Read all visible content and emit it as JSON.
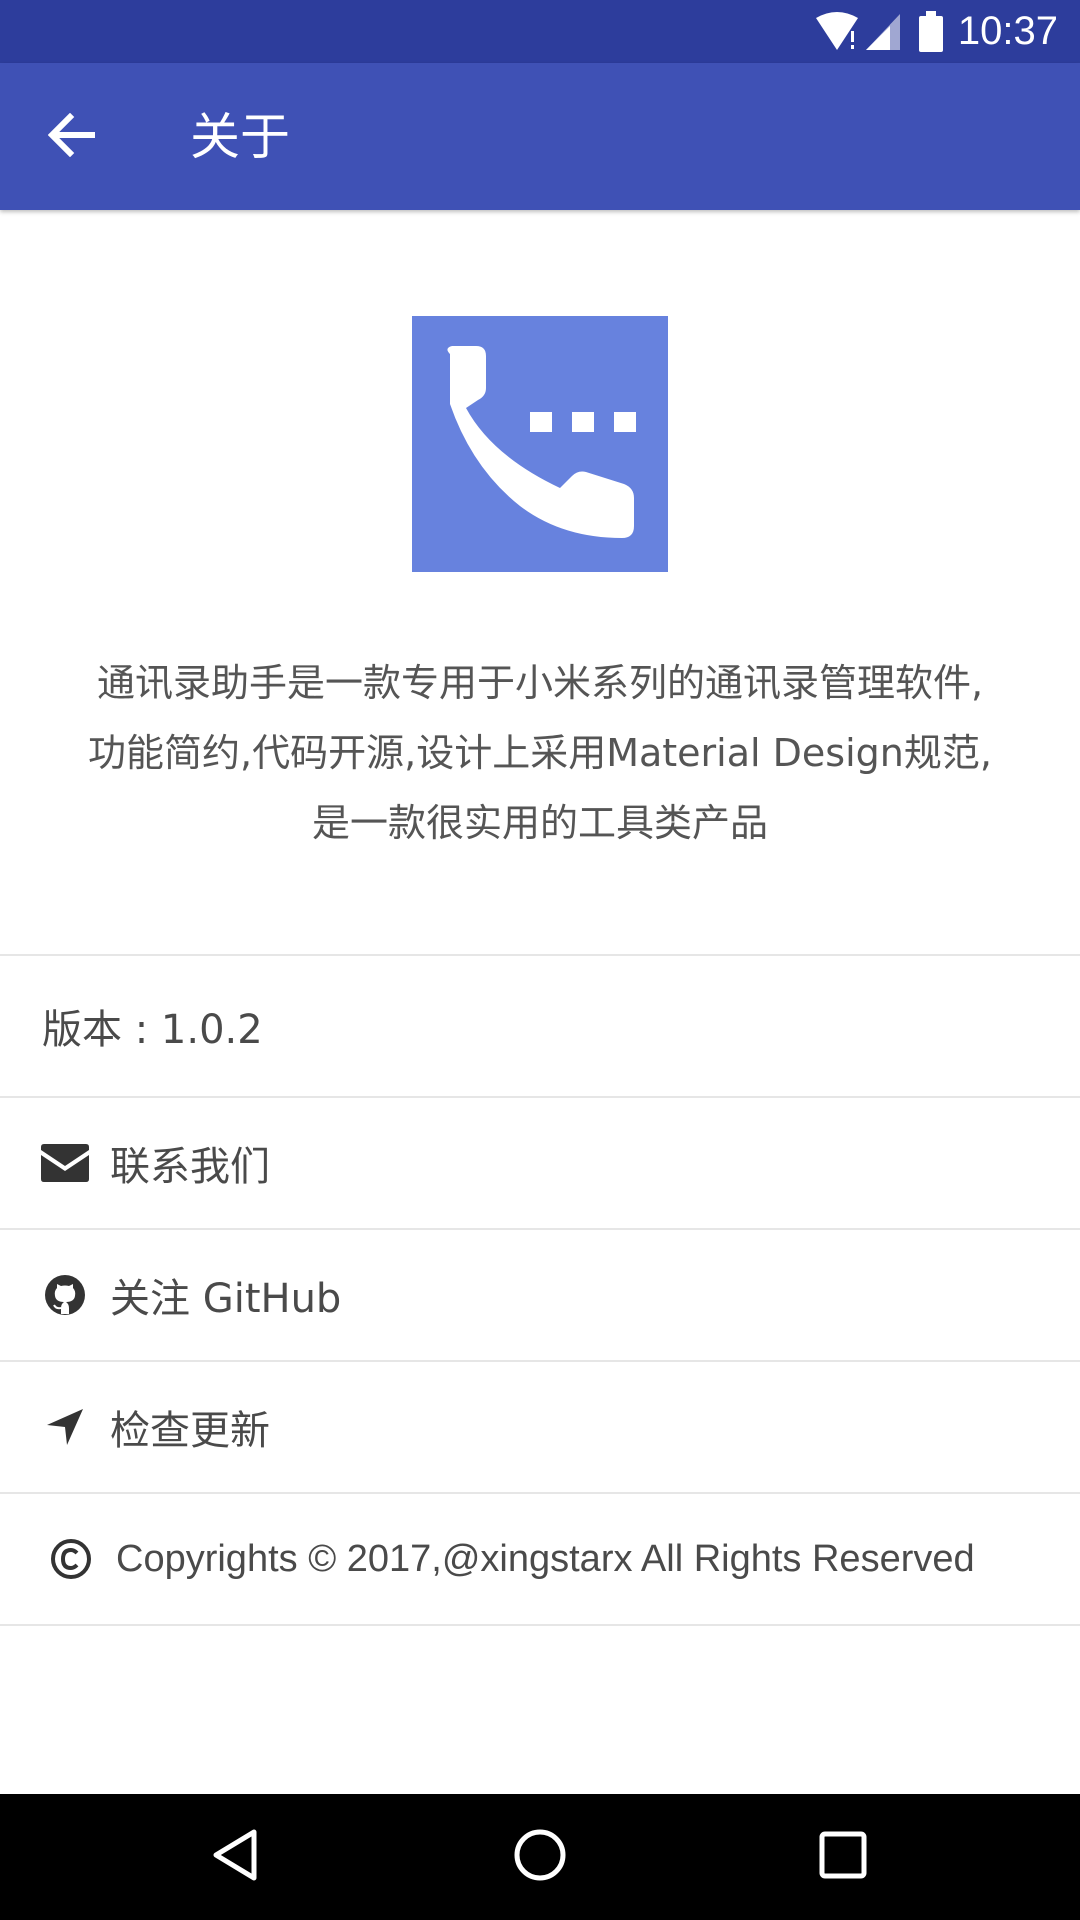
{
  "status_bar": {
    "time": "10:37",
    "icons": [
      "wifi-icon",
      "cell-signal-icon",
      "battery-icon"
    ]
  },
  "app_bar": {
    "title": "关于",
    "back_icon": "arrow-back-icon"
  },
  "logo": {
    "icon": "phone-dialpad-icon",
    "background_color": "#6782de"
  },
  "description": {
    "lines": [
      "通讯录助手是一款专用于小米系列的通讯录管理软件,",
      "功能简约,代码开源,设计上采用Material Design规范,",
      "是一款很实用的工具类产品"
    ]
  },
  "items": {
    "version": "版本 : 1.0.2",
    "contact": {
      "label": "联系我们",
      "icon": "mail-icon"
    },
    "github": {
      "label": "关注 GitHub",
      "icon": "github-icon"
    },
    "update": {
      "label": "检查更新",
      "icon": "navigation-arrow-icon"
    },
    "copyright": {
      "label": "Copyrights © 2017,@xingstarx All Rights Reserved",
      "icon": "copyright-icon"
    }
  },
  "nav_bar": {
    "icons": [
      "back-triangle-icon",
      "home-circle-icon",
      "recents-square-icon"
    ]
  },
  "colors": {
    "status_bar": "#2d3d9c",
    "app_bar": "#3f51b5",
    "accent": "#6782de"
  }
}
